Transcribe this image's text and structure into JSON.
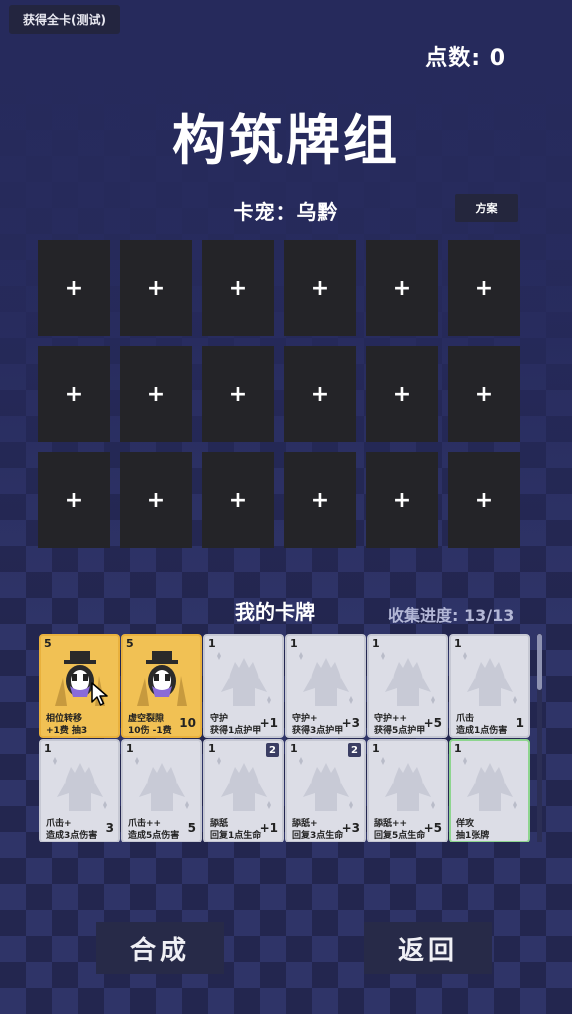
{
  "header": {
    "test_button_label": "获得全卡(测试)",
    "points_label": "点数: 0",
    "title": "构筑牌组",
    "pet_label": "卡宠：乌黔",
    "plan_button_label": "方案"
  },
  "deck": {
    "slot_symbol": "+"
  },
  "collection": {
    "title": "我的卡牌",
    "progress": "收集进度: 13/13",
    "cards": [
      {
        "cost": "5",
        "badge": "",
        "name": "相位转移",
        "desc": "+1费 抽3",
        "value": "",
        "style": "gold",
        "art": "wizard"
      },
      {
        "cost": "5",
        "badge": "",
        "name": "虚空裂隙",
        "desc": "10伤 -1费",
        "value": "10",
        "style": "gold",
        "art": "wizard"
      },
      {
        "cost": "1",
        "badge": "",
        "name": "守护",
        "desc": "获得1点护甲",
        "value": "+1",
        "style": "plain",
        "art": "silhouette"
      },
      {
        "cost": "1",
        "badge": "",
        "name": "守护+",
        "desc": "获得3点护甲",
        "value": "+3",
        "style": "plain",
        "art": "silhouette"
      },
      {
        "cost": "1",
        "badge": "",
        "name": "守护++",
        "desc": "获得5点护甲",
        "value": "+5",
        "style": "plain",
        "art": "silhouette"
      },
      {
        "cost": "1",
        "badge": "",
        "name": "爪击",
        "desc": "造成1点伤害",
        "value": "1",
        "style": "plain",
        "art": "silhouette"
      },
      {
        "cost": "1",
        "badge": "",
        "name": "爪击+",
        "desc": "造成3点伤害",
        "value": "3",
        "style": "plain",
        "art": "silhouette"
      },
      {
        "cost": "1",
        "badge": "",
        "name": "爪击++",
        "desc": "造成5点伤害",
        "value": "5",
        "style": "plain",
        "art": "silhouette"
      },
      {
        "cost": "1",
        "badge": "2",
        "name": "舔舐",
        "desc": "回复1点生命",
        "value": "+1",
        "style": "plain",
        "art": "silhouette"
      },
      {
        "cost": "1",
        "badge": "2",
        "name": "舔舐+",
        "desc": "回复3点生命",
        "value": "+3",
        "style": "plain",
        "art": "silhouette"
      },
      {
        "cost": "1",
        "badge": "",
        "name": "舔舐++",
        "desc": "回复5点生命",
        "value": "+5",
        "style": "plain",
        "art": "silhouette"
      },
      {
        "cost": "1",
        "badge": "",
        "name": "佯攻",
        "desc": "抽1张牌",
        "value": "",
        "style": "green",
        "art": "silhouette"
      }
    ]
  },
  "footer": {
    "compose_label": "合成",
    "back_label": "返回"
  },
  "colors": {
    "background": "#2a2e5e",
    "slot": "#242428",
    "gold_card": "#f1c154",
    "plain_card": "#dcdde6",
    "button": "#272a48"
  }
}
